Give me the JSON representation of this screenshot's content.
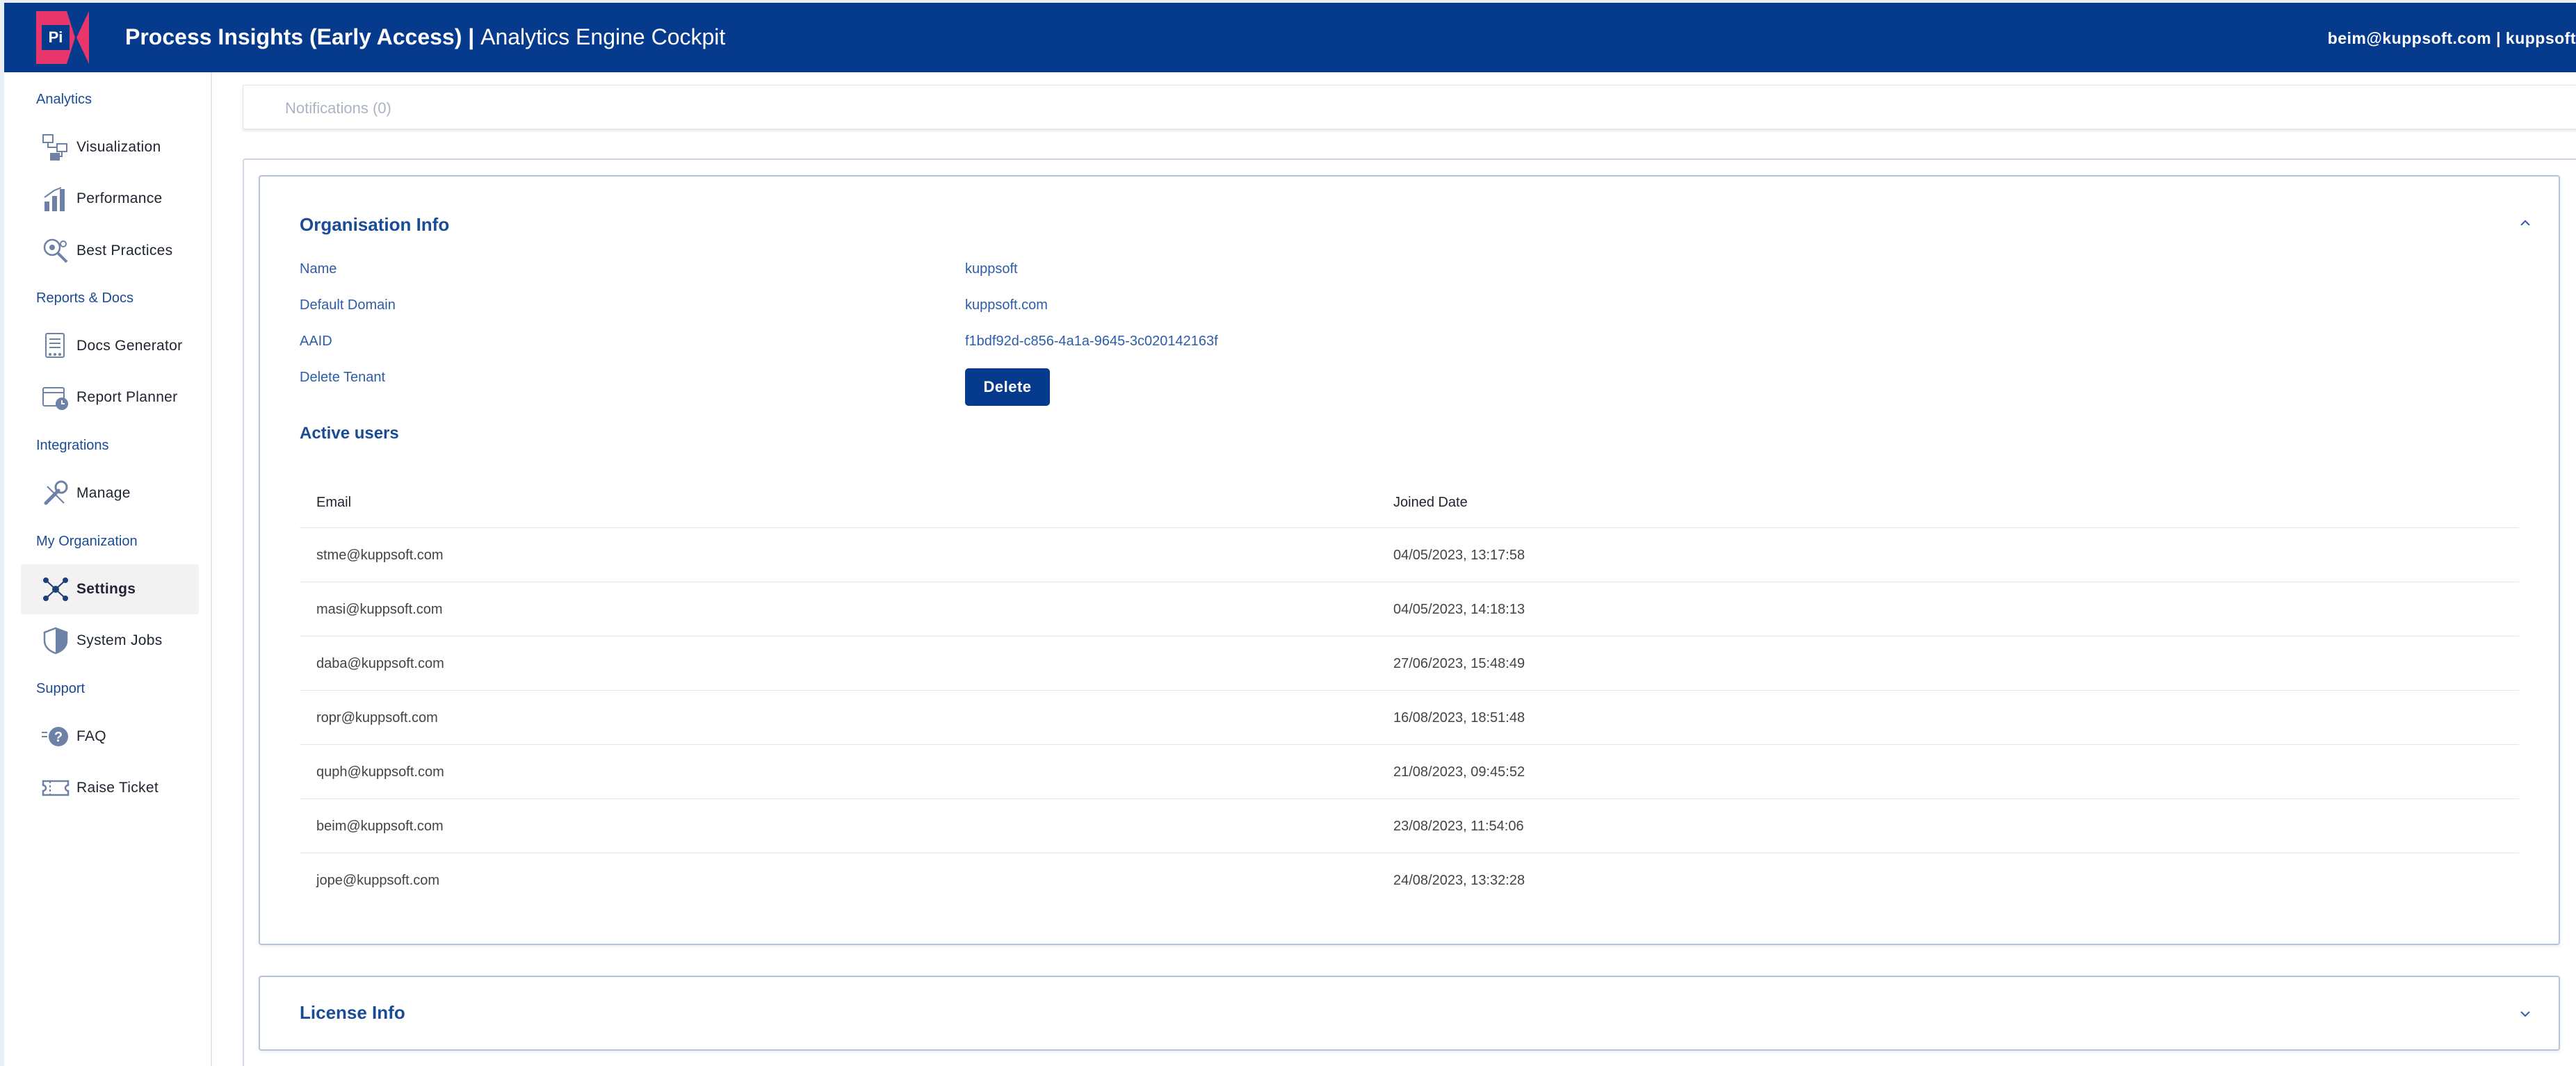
{
  "header": {
    "logo_text": "Pi",
    "title_bold": "Process Insights (Early Access)",
    "title_sep": " | ",
    "title_rest": "Analytics Engine Cockpit",
    "user": "beim@kuppsoft.com | kuppsoft",
    "bg_color": "#063a8c",
    "logo_color": "#e8366c"
  },
  "sidebar": {
    "sections": [
      {
        "label": "Analytics"
      },
      {
        "label": "Reports & Docs"
      },
      {
        "label": "Integrations"
      },
      {
        "label": "My Organization"
      },
      {
        "label": "Support"
      }
    ],
    "items": [
      {
        "label": "Visualization",
        "icon": "flow-diagram-icon"
      },
      {
        "label": "Performance",
        "icon": "bar-chart-icon"
      },
      {
        "label": "Best Practices",
        "icon": "magnifier-gear-icon"
      },
      {
        "label": "Docs Generator",
        "icon": "document-icon"
      },
      {
        "label": "Report Planner",
        "icon": "calendar-clock-icon"
      },
      {
        "label": "Manage",
        "icon": "wrench-icon"
      },
      {
        "label": "Settings",
        "icon": "network-icon",
        "active": true
      },
      {
        "label": "System Jobs",
        "icon": "shield-icon"
      },
      {
        "label": "FAQ",
        "icon": "question-icon"
      },
      {
        "label": "Raise Ticket",
        "icon": "ticket-icon"
      }
    ]
  },
  "notifications": {
    "label": "Notifications (0)"
  },
  "org_info": {
    "title": "Organisation Info",
    "name_label": "Name",
    "name_value": "kuppsoft",
    "domain_label": "Default Domain",
    "domain_value": "kuppsoft.com",
    "aaid_label": "AAID",
    "aaid_value": "f1bdf92d-c856-4a1a-9645-3c020142163f",
    "delete_label": "Delete Tenant",
    "delete_button": "Delete"
  },
  "active_users": {
    "title": "Active users",
    "columns": [
      "Email",
      "Joined Date"
    ],
    "rows": [
      [
        "stme@kuppsoft.com",
        "04/05/2023, 13:17:58"
      ],
      [
        "masi@kuppsoft.com",
        "04/05/2023, 14:18:13"
      ],
      [
        "daba@kuppsoft.com",
        "27/06/2023, 15:48:49"
      ],
      [
        "ropr@kuppsoft.com",
        "16/08/2023, 18:51:48"
      ],
      [
        "quph@kuppsoft.com",
        "21/08/2023, 09:45:52"
      ],
      [
        "beim@kuppsoft.com",
        "23/08/2023, 11:54:06"
      ],
      [
        "jope@kuppsoft.com",
        "24/08/2023, 13:32:28"
      ]
    ]
  },
  "license_info": {
    "title": "License Info"
  }
}
